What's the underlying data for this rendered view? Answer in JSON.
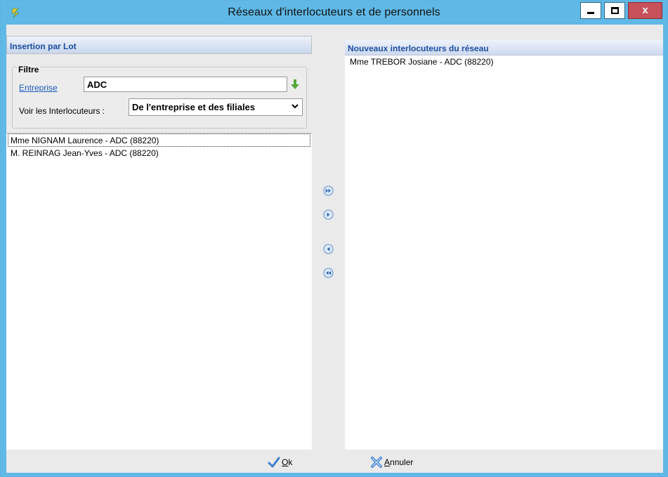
{
  "window": {
    "title": "Réseaux d'interlocuteurs et de personnels",
    "close_glyph": "x"
  },
  "left_panel": {
    "header": "Insertion par Lot",
    "filter": {
      "legend": "Filtre",
      "entreprise_label": "Entreprise",
      "entreprise_value": "ADC",
      "voir_label": "Voir les Interlocuteurs :",
      "voir_selected": "De l'entreprise et des filiales"
    },
    "items": [
      "Mme NIGNAM Laurence - ADC (88220)",
      "M. REINRAG Jean-Yves - ADC (88220)"
    ]
  },
  "transfer_buttons": [
    {
      "icon": "move-all-right-icon"
    },
    {
      "icon": "move-right-icon"
    },
    {
      "icon": "move-left-icon"
    },
    {
      "icon": "move-all-left-icon"
    }
  ],
  "right_panel": {
    "header": "Nouveaux interlocuteurs du réseau",
    "items": [
      "Mme TREBOR Josiane - ADC (88220)"
    ]
  },
  "footer": {
    "ok_label": "Ok",
    "cancel_label": "Annuler"
  },
  "colors": {
    "titlebar": "#5fb8e6",
    "header_text": "#1c4da1",
    "close_button": "#c7505a"
  }
}
